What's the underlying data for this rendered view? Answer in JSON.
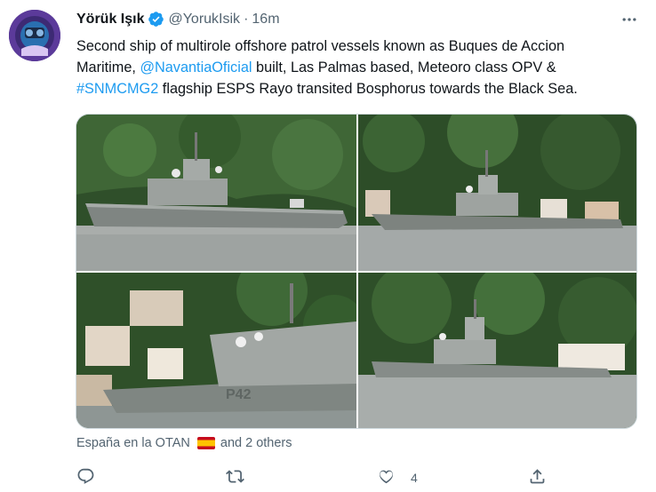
{
  "author": {
    "name": "Yörük Işık",
    "handle": "@YorukIsik",
    "separator": "·",
    "time": "16m"
  },
  "tweet": {
    "line1": "Second ship of multirole offshore patrol vessels known as Buques de Accion",
    "line2_a": "Maritime, ",
    "mention": "@NavantiaOficial",
    "line2_b": " built, Las Palmas based, Meteoro class OPV &",
    "hashtag": "#SNMCMG2",
    "line3_b": " flagship ESPS Rayo transited Bosphorus towards the Black Sea."
  },
  "media": {
    "photos": [
      "photo-1",
      "photo-2",
      "photo-3",
      "photo-4"
    ],
    "hull_marking": "P42"
  },
  "social_context": {
    "account": "España en la OTAN",
    "suffix": "and 2 others"
  },
  "actions": {
    "reply_count": "",
    "retweet_count": "",
    "like_count": "4",
    "share_count": ""
  },
  "colors": {
    "accent": "#1d9bf0",
    "secondary_text": "#536471",
    "primary_text": "#0f1419"
  }
}
